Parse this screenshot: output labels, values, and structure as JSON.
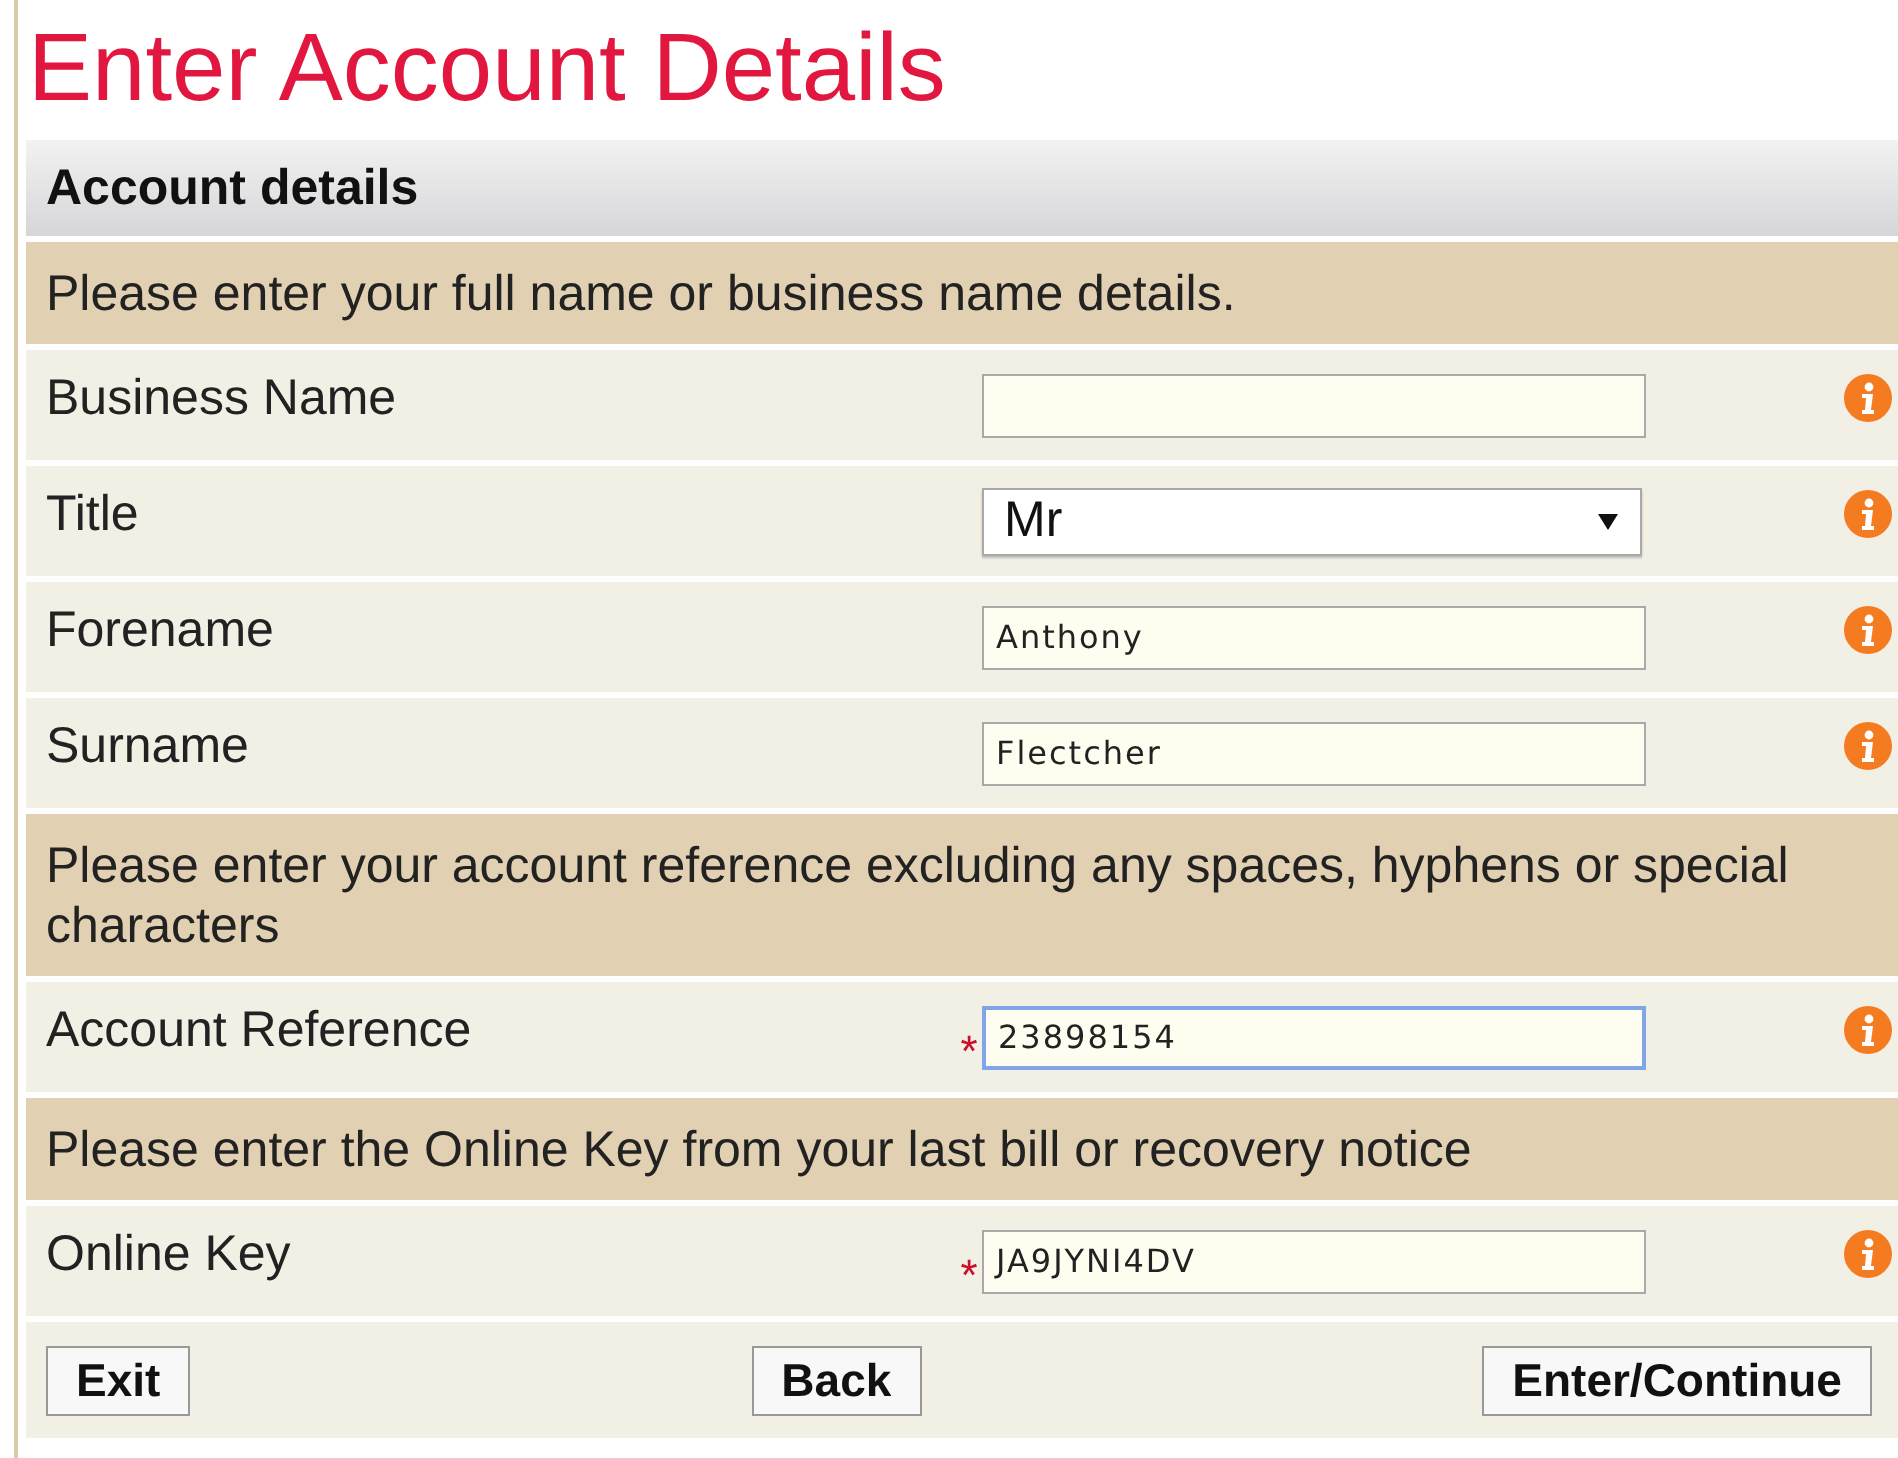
{
  "page_title": "Enter Account Details",
  "section": {
    "title": "Account details"
  },
  "rows": [
    {
      "kind": "instruction",
      "text": "Please enter your full name or business name details."
    },
    {
      "kind": "text",
      "label": "Business Name",
      "value": "",
      "required": false,
      "focused": false
    },
    {
      "kind": "select",
      "label": "Title",
      "value": "Mr",
      "required": false,
      "focused": false
    },
    {
      "kind": "text",
      "label": "Forename",
      "value": "Anthony",
      "required": false,
      "focused": false
    },
    {
      "kind": "text",
      "label": "Surname",
      "value": "Flectcher",
      "required": false,
      "focused": false
    },
    {
      "kind": "instruction",
      "text": "Please enter your account reference excluding any spaces, hyphens or special characters"
    },
    {
      "kind": "text",
      "label": "Account Reference",
      "value": "23898154",
      "required": true,
      "focused": true
    },
    {
      "kind": "instruction",
      "text": "Please enter the Online Key from your last bill or recovery notice"
    },
    {
      "kind": "text",
      "label": "Online Key",
      "value": "JA9JYNI4DV",
      "required": true,
      "focused": false
    }
  ],
  "required_mark": "*",
  "buttons": [
    "Exit",
    "Back",
    "Enter/Continue"
  ]
}
